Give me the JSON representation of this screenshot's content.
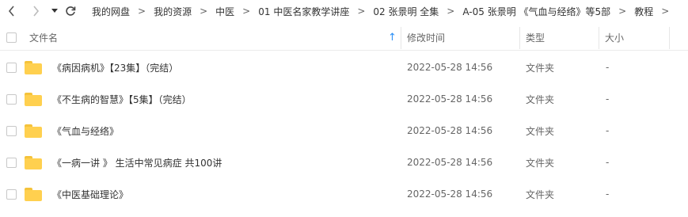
{
  "breadcrumb": [
    "我的网盘",
    "我的资源",
    "中医",
    "01 中医名家教学讲座",
    "02 张景明 全集",
    "A-05 张景明 《气血与经络》等5部",
    "教程"
  ],
  "breadcrumb_separator": ">",
  "columns": {
    "name": "文件名",
    "modified": "修改时间",
    "type": "类型",
    "size": "大小"
  },
  "sort_indicator": "↑",
  "sort_color": "#2b8ff6",
  "folder_color": "#ffd04f",
  "rows": [
    {
      "name": "《病因病机》【23集】（完结）",
      "modified": "2022-05-28 14:56",
      "type": "文件夹",
      "size": "-"
    },
    {
      "name": "《不生病的智慧》【5集】（完结）",
      "modified": "2022-05-28 14:56",
      "type": "文件夹",
      "size": "-"
    },
    {
      "name": "《气血与经络》",
      "modified": "2022-05-28 14:56",
      "type": "文件夹",
      "size": "-"
    },
    {
      "name": "《一病一讲 》 生活中常见病症 共100讲",
      "modified": "2022-05-28 14:56",
      "type": "文件夹",
      "size": "-"
    },
    {
      "name": "《中医基础理论》",
      "modified": "2022-05-28 14:56",
      "type": "文件夹",
      "size": "-"
    }
  ]
}
